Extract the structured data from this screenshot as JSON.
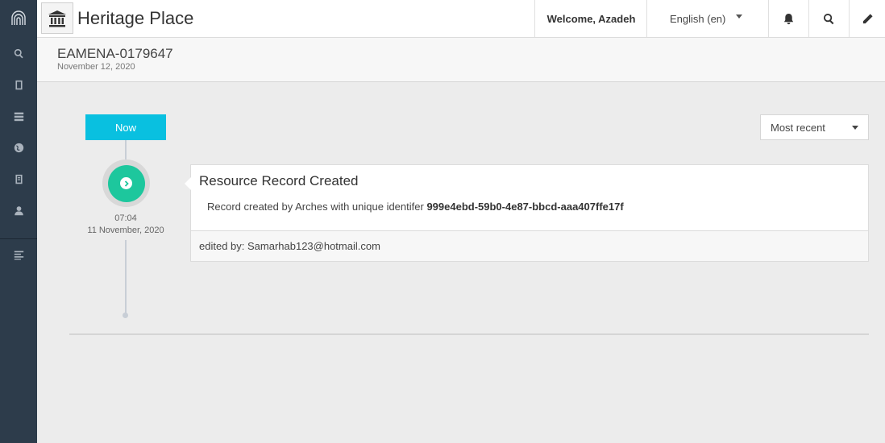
{
  "app": {
    "title": "Heritage Place"
  },
  "topbar": {
    "welcome": "Welcome, Azadeh",
    "language": "English (en)",
    "icons": [
      "bell-icon",
      "search-icon",
      "edit-icon"
    ]
  },
  "sidebar": {
    "items": [
      "search-icon",
      "book-icon",
      "layers-icon",
      "globe-icon",
      "clipboard-icon",
      "user-icon",
      "list-icon"
    ]
  },
  "resource": {
    "id": "EAMENA-0179647",
    "date": "November 12, 2020"
  },
  "timeline": {
    "now_label": "Now",
    "sort_label": "Most recent",
    "entry": {
      "time": "07:04",
      "date": "11 November, 2020",
      "title": "Resource Record Created",
      "body_prefix": "Record created by Arches with unique identifer",
      "identifier": "999e4ebd-59b0-4e87-bbcd-aaa407ffe17f",
      "edited_by": "edited by: Samarhab123@hotmail.com"
    }
  },
  "colors": {
    "sidebar": "#2d3c4b",
    "now_button": "#09c0e0",
    "event_circle": "#1dc79d"
  }
}
